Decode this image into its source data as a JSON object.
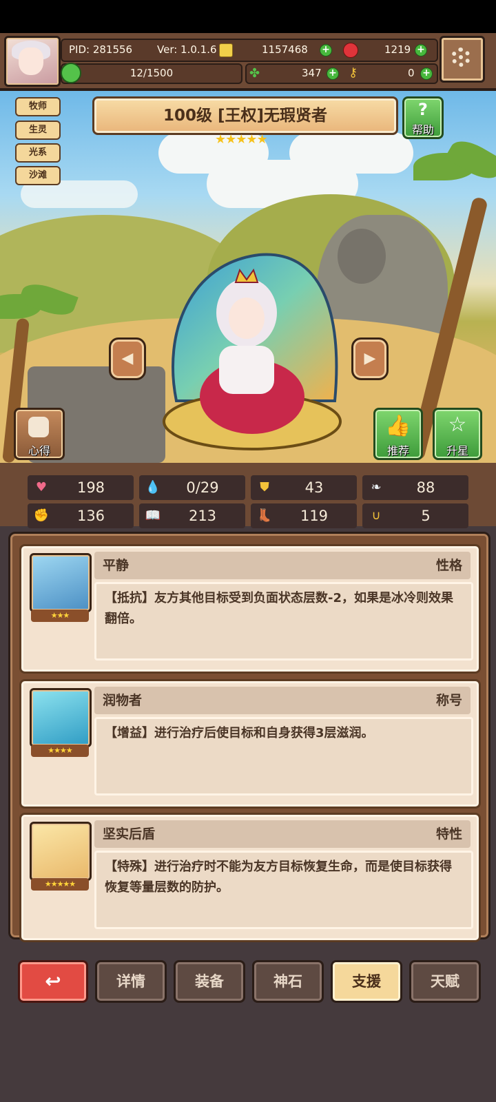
{
  "header": {
    "pid": "PID: 281556",
    "version": "Ver: 1.0.1.6",
    "gold": "1157468",
    "ruby": "1219",
    "clover": "347",
    "key": "0",
    "stamina": "12/1500"
  },
  "tags": [
    "牧师",
    "生灵",
    "光系",
    "沙滩"
  ],
  "hero": {
    "title": "100级 [王权]无瑕贤者",
    "stars": 5
  },
  "buttons": {
    "help": "帮助",
    "notes": "心得",
    "recommend": "推荐",
    "starup": "升星"
  },
  "stats": [
    {
      "icon": "heart-icon",
      "value": "198"
    },
    {
      "icon": "water-drop-icon",
      "value": "0/29"
    },
    {
      "icon": "shield-icon",
      "value": "43"
    },
    {
      "icon": "wing-icon",
      "value": "88"
    },
    {
      "icon": "fist-icon",
      "value": "136"
    },
    {
      "icon": "book-icon",
      "value": "213"
    },
    {
      "icon": "boot-icon",
      "value": "119"
    },
    {
      "icon": "horseshoe-icon",
      "value": "5"
    }
  ],
  "cards": [
    {
      "name": "平静",
      "type": "性格",
      "stars": 3,
      "desc": "【抵抗】友方其他目标受到负面状态层数-2，如果是冰冷则效果翻倍。"
    },
    {
      "name": "润物者",
      "type": "称号",
      "stars": 4,
      "desc": "【增益】进行治疗后使目标和自身获得3层滋润。"
    },
    {
      "name": "坚实后盾",
      "type": "特性",
      "stars": 5,
      "desc": "【特殊】进行治疗时不能为友方目标恢复生命，而是使目标获得恢复等量层数的防护。"
    }
  ],
  "nav": {
    "back": "↩",
    "tabs": [
      "详情",
      "装备",
      "神石",
      "支援",
      "天赋"
    ],
    "active_index": 3
  },
  "colors": {
    "gold_star": "#f6c21c",
    "green_button": "#3d9b3a",
    "red_button": "#e24b43",
    "active_tab": "#f5d89b"
  }
}
